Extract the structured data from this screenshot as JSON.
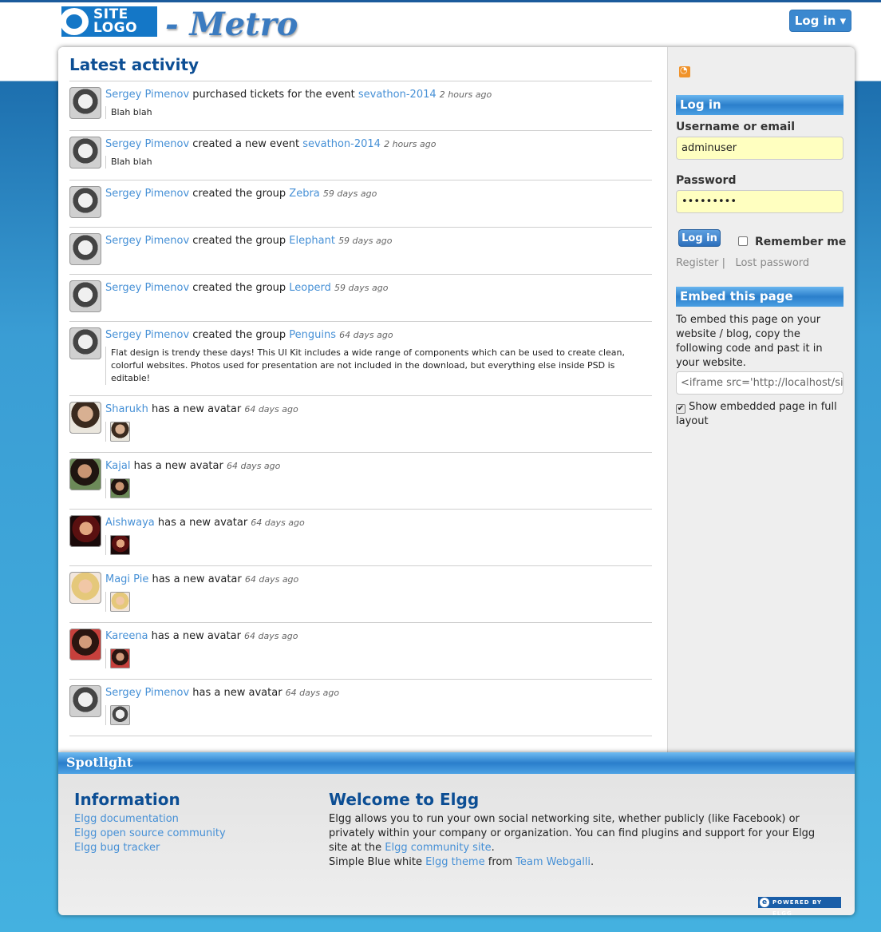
{
  "header": {
    "logo_line1": "SITE",
    "logo_line2": "LOGO",
    "site_name": "- Metro",
    "login_label": "Log in ▾"
  },
  "main": {
    "title": "Latest activity",
    "items": [
      {
        "user": "Sergey Pimenov",
        "action": " purchased tickets for the event ",
        "target": "sevathon-2014",
        "time": "2 hours ago",
        "quote": "Blah blah"
      },
      {
        "user": "Sergey Pimenov",
        "action": " created a new event ",
        "target": "sevathon-2014",
        "time": "2 hours ago",
        "quote": "Blah blah"
      },
      {
        "user": "Sergey Pimenov",
        "action": " created the group ",
        "target": "Zebra",
        "time": "59 days ago"
      },
      {
        "user": "Sergey Pimenov",
        "action": " created the group ",
        "target": "Elephant",
        "time": "59 days ago"
      },
      {
        "user": "Sergey Pimenov",
        "action": " created the group ",
        "target": "Leoperd",
        "time": "59 days ago"
      },
      {
        "user": "Sergey Pimenov",
        "action": " created the group ",
        "target": "Penguins",
        "time": "64 days ago",
        "quote": "Flat design is trendy these days! This UI Kit includes a wide range of components which can be used to create clean, colorful websites. Photos used for presentation are not included in the download, but everything else inside PSD is editable!"
      },
      {
        "user": "Sharukh",
        "action": " has a new avatar ",
        "time": "64 days ago"
      },
      {
        "user": "Kajal",
        "action": " has a new avatar ",
        "time": "64 days ago"
      },
      {
        "user": "Aishwaya",
        "action": " has a new avatar ",
        "time": "64 days ago"
      },
      {
        "user": "Magi Pie",
        "action": " has a new avatar ",
        "time": "64 days ago"
      },
      {
        "user": "Kareena",
        "action": " has a new avatar ",
        "time": "64 days ago"
      },
      {
        "user": "Sergey Pimenov",
        "action": " has a new avatar ",
        "time": "64 days ago"
      }
    ]
  },
  "sidebar": {
    "login_heading": "Log in",
    "username_label": "Username or email",
    "username_value": "adminuser",
    "password_label": "Password",
    "password_value": "•••••••••",
    "login_button": "Log in",
    "remember_label": "Remember me",
    "register_link": "Register",
    "separator": "|",
    "lost_password_link": "Lost password",
    "embed_heading": "Embed this page",
    "embed_text": "To embed this page on your website / blog, copy the following code and past it in your website.",
    "embed_code": "<iframe src='http://localhost/sit",
    "show_embedded_label": "Show embedded page in full layout"
  },
  "footer": {
    "spotlight_heading": "Spotlight",
    "info_title": "Information",
    "info_links": [
      "Elgg documentation",
      "Elgg open source community",
      "Elgg bug tracker"
    ],
    "welcome_title": "Welcome to Elgg",
    "welcome_text1": "Elgg allows you to run your own social networking site, whether publicly (like Facebook) or privately within your company or organization. You can find plugins and support for your Elgg site at the ",
    "community_link": "Elgg community site",
    "welcome_text2": ".",
    "simple_text1": "Simple Blue white ",
    "theme_link": "Elgg theme",
    "simple_text2": " from ",
    "team_link": "Team Webgalli",
    "simple_text3": ".",
    "powered": "POWERED BY ELGG"
  },
  "colors": {
    "link": "#4690d6",
    "heading": "#0c4e94",
    "header_bar": "#2b7fcb",
    "input_bg": "#ffffc0"
  }
}
